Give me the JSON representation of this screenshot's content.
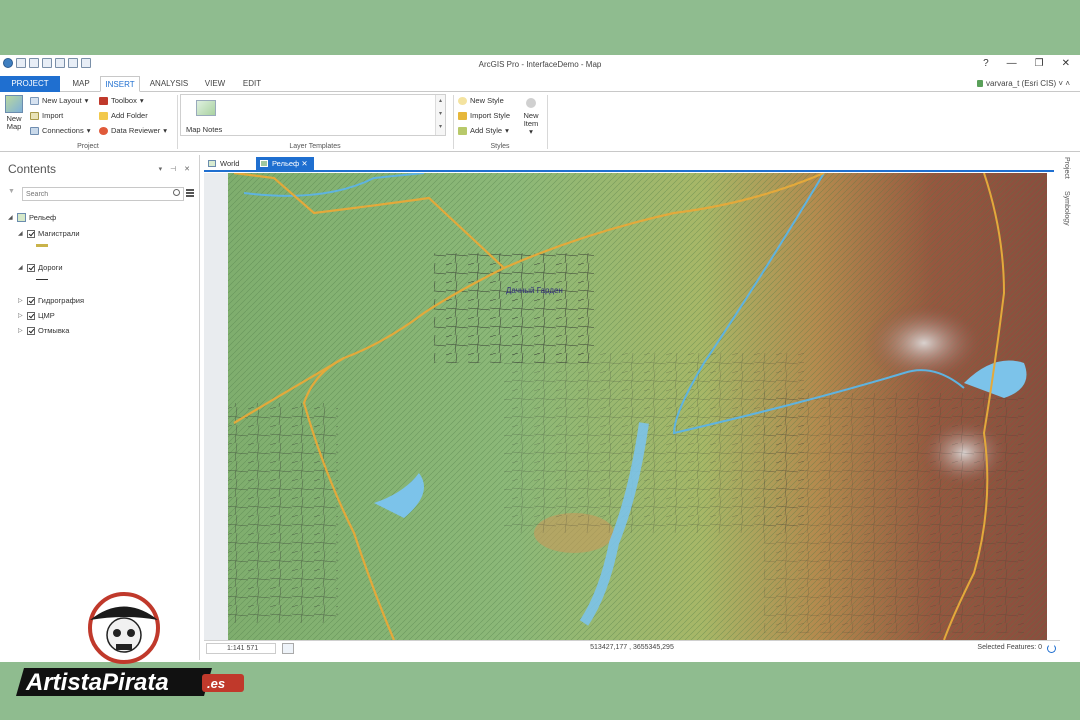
{
  "window": {
    "title": "ArcGIS Pro - InterfaceDemo - Map",
    "controls": [
      "?",
      "—",
      "❐",
      "✕"
    ]
  },
  "tabs": [
    "PROJECT",
    "MAP",
    "INSERT",
    "ANALYSIS",
    "VIEW",
    "EDIT"
  ],
  "active_tab": "INSERT",
  "user": "varvara_t (Esri CIS)",
  "ribbon": {
    "project_group": {
      "label": "Project",
      "new_map": "New Map",
      "new_layout": "New Layout",
      "import": "Import",
      "connections": "Connections",
      "toolbox": "Toolbox",
      "add_folder": "Add Folder",
      "data_reviewer": "Data Reviewer"
    },
    "layer_templates_group": {
      "label": "Layer Templates",
      "map_notes": "Map Notes"
    },
    "styles_group": {
      "label": "Styles",
      "new_style": "New Style",
      "import_style": "Import Style",
      "add_style": "Add Style",
      "new_item": "New Item"
    }
  },
  "contents": {
    "title": "Contents",
    "search_placeholder": "Search",
    "layers": {
      "map": "Рельеф",
      "highways": "Магистрали",
      "roads": "Дороги",
      "hydrography": "Гидрография",
      "dem": "ЦМР",
      "hillshade": "Отмывка"
    }
  },
  "map_tabs": [
    "World",
    "Рельеф"
  ],
  "active_map_tab": "Рельеф",
  "map": {
    "label": "Дачный Гарден"
  },
  "status": {
    "scale": "1:141 571",
    "coordinates": "513427,177 , 3655345,295",
    "selected_features": "Selected Features: 0"
  },
  "side_tabs": [
    "Project",
    "Symbology"
  ],
  "watermark": {
    "text_main": "ArtistaPirata",
    "text_suffix": ".es"
  },
  "colors": {
    "accent": "#1f6fd0",
    "background": "#8fbc8f",
    "highway": "#e3a93b",
    "water": "#5fb3e0"
  }
}
